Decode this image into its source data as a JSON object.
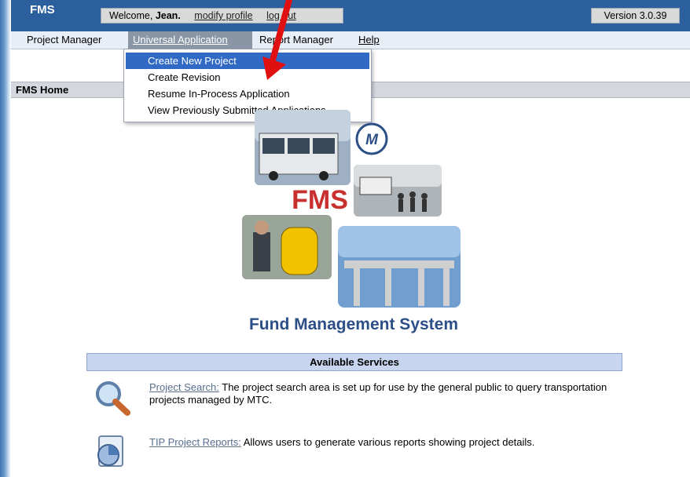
{
  "topbar": {
    "brand": "FMS",
    "welcome_prefix": "Welcome,",
    "user_name": "Jean.",
    "modify_profile": "modify profile",
    "logout": "log out",
    "version": "Version 3.0.39"
  },
  "menubar": {
    "items": [
      {
        "label": "Project Manager",
        "active": false
      },
      {
        "label": "Universal Application",
        "active": true
      },
      {
        "label": "Report Manager",
        "active": false
      },
      {
        "label": "Help",
        "active": false
      }
    ]
  },
  "dropdown": {
    "items": [
      {
        "label": "Create New Project",
        "selected": true
      },
      {
        "label": "Create Revision",
        "selected": false
      },
      {
        "label": "Resume In-Process Application",
        "selected": false
      },
      {
        "label": "View Previously Submitted Applications",
        "selected": false
      }
    ]
  },
  "page": {
    "section_title": "FMS Home"
  },
  "logo": {
    "badge_text": "M",
    "fms_text": "FMS",
    "subtitle": "Fund Management System"
  },
  "services": {
    "header": "Available Services",
    "items": [
      {
        "icon": "magnifier-icon",
        "link": "Project Search:",
        "description": "The project search area is set up for use by the general public to query transportation projects managed by MTC."
      },
      {
        "icon": "report-icon",
        "link": "TIP Project Reports:",
        "description": "Allows users to generate various reports showing project details."
      }
    ]
  },
  "colors": {
    "topbar": "#2b5f9e",
    "menu_active": "#8a96a6",
    "dropdown_selected": "#316ac5",
    "fms_red": "#c8302f",
    "subtitle_blue": "#2b4f86",
    "annotation_arrow": "#e01010"
  }
}
